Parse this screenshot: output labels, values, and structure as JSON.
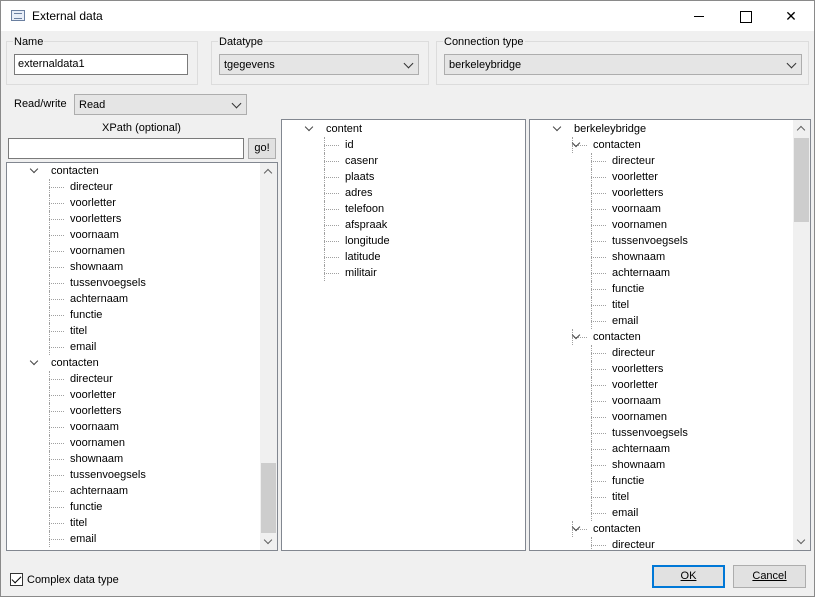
{
  "window": {
    "title": "External data",
    "close_glyph": "✕"
  },
  "name_group": {
    "label": "Name",
    "value": "externaldata1"
  },
  "datatype_group": {
    "label": "Datatype",
    "value": "tgegevens"
  },
  "connection_group": {
    "label": "Connection type",
    "value": "berkeleybridge"
  },
  "read_write": {
    "label": "Read/write",
    "value": "Read"
  },
  "xpath": {
    "label": "XPath (optional)",
    "value": "",
    "go_label": "go!"
  },
  "left_tree": {
    "items": [
      {
        "label": "contacten",
        "level": 0,
        "expanded": true
      },
      {
        "label": "directeur",
        "level": 1
      },
      {
        "label": "voorletter",
        "level": 1
      },
      {
        "label": "voorletters",
        "level": 1
      },
      {
        "label": "voornaam",
        "level": 1
      },
      {
        "label": "voornamen",
        "level": 1
      },
      {
        "label": "shownaam",
        "level": 1
      },
      {
        "label": "tussenvoegsels",
        "level": 1
      },
      {
        "label": "achternaam",
        "level": 1
      },
      {
        "label": "functie",
        "level": 1
      },
      {
        "label": "titel",
        "level": 1
      },
      {
        "label": "email",
        "level": 1
      },
      {
        "label": "contacten",
        "level": 0,
        "expanded": true
      },
      {
        "label": "directeur",
        "level": 1
      },
      {
        "label": "voorletter",
        "level": 1
      },
      {
        "label": "voorletters",
        "level": 1
      },
      {
        "label": "voornaam",
        "level": 1
      },
      {
        "label": "voornamen",
        "level": 1
      },
      {
        "label": "shownaam",
        "level": 1
      },
      {
        "label": "tussenvoegsels",
        "level": 1
      },
      {
        "label": "achternaam",
        "level": 1
      },
      {
        "label": "functie",
        "level": 1
      },
      {
        "label": "titel",
        "level": 1
      },
      {
        "label": "email",
        "level": 1
      }
    ]
  },
  "middle_tree": {
    "items": [
      {
        "label": "content",
        "level": 0,
        "expanded": true
      },
      {
        "label": "id",
        "level": 1
      },
      {
        "label": "casenr",
        "level": 1
      },
      {
        "label": "plaats",
        "level": 1
      },
      {
        "label": "adres",
        "level": 1
      },
      {
        "label": "telefoon",
        "level": 1
      },
      {
        "label": "afspraak",
        "level": 1
      },
      {
        "label": "longitude",
        "level": 1
      },
      {
        "label": "latitude",
        "level": 1
      },
      {
        "label": "militair",
        "level": 1
      }
    ]
  },
  "right_tree": {
    "items": [
      {
        "label": "berkeleybridge",
        "level": 0,
        "expanded": true
      },
      {
        "label": "contacten",
        "level": 1,
        "expanded": true
      },
      {
        "label": "directeur",
        "level": 2
      },
      {
        "label": "voorletter",
        "level": 2
      },
      {
        "label": "voorletters",
        "level": 2
      },
      {
        "label": "voornaam",
        "level": 2
      },
      {
        "label": "voornamen",
        "level": 2
      },
      {
        "label": "tussenvoegsels",
        "level": 2
      },
      {
        "label": "shownaam",
        "level": 2
      },
      {
        "label": "achternaam",
        "level": 2
      },
      {
        "label": "functie",
        "level": 2
      },
      {
        "label": "titel",
        "level": 2
      },
      {
        "label": "email",
        "level": 2
      },
      {
        "label": "contacten",
        "level": 1,
        "expanded": true
      },
      {
        "label": "directeur",
        "level": 2
      },
      {
        "label": "voorletters",
        "level": 2
      },
      {
        "label": "voorletter",
        "level": 2
      },
      {
        "label": "voornaam",
        "level": 2
      },
      {
        "label": "voornamen",
        "level": 2
      },
      {
        "label": "tussenvoegsels",
        "level": 2
      },
      {
        "label": "achternaam",
        "level": 2
      },
      {
        "label": "shownaam",
        "level": 2
      },
      {
        "label": "functie",
        "level": 2
      },
      {
        "label": "titel",
        "level": 2
      },
      {
        "label": "email",
        "level": 2
      },
      {
        "label": "contacten",
        "level": 1,
        "expanded": true
      },
      {
        "label": "directeur",
        "level": 2
      }
    ]
  },
  "complex_checkbox": {
    "label": "Complex data type",
    "checked": true
  },
  "buttons": {
    "ok": "OK",
    "cancel": "Cancel"
  }
}
